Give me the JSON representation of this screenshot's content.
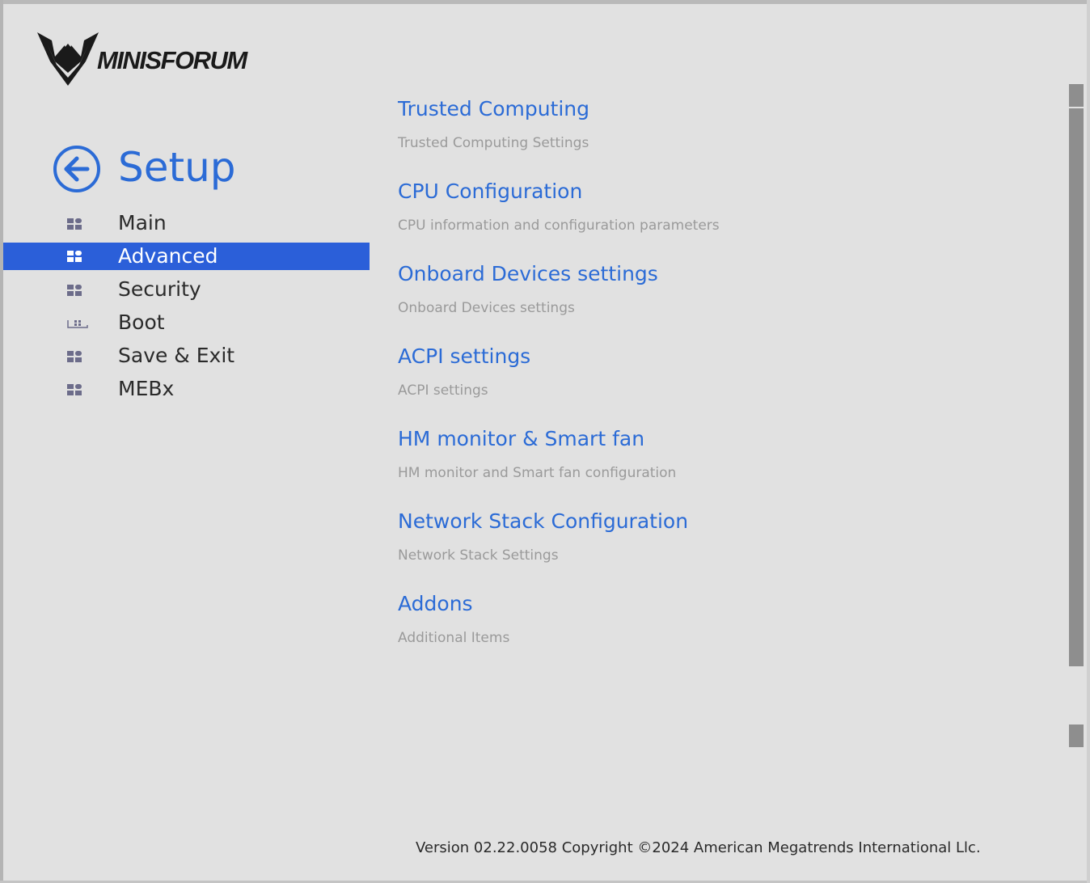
{
  "brand": {
    "logo_text": "MINISFORUM"
  },
  "setup": {
    "title": "Setup",
    "back_icon": "arrow-left-circle-icon"
  },
  "nav": {
    "items": [
      {
        "label": "Main",
        "icon": "grid-icon",
        "active": false
      },
      {
        "label": "Advanced",
        "icon": "grid-icon",
        "active": true
      },
      {
        "label": "Security",
        "icon": "grid-icon",
        "active": false
      },
      {
        "label": "Boot",
        "icon": "boot-drive-icon",
        "active": false
      },
      {
        "label": "Save & Exit",
        "icon": "grid-icon",
        "active": false
      },
      {
        "label": "MEBx",
        "icon": "grid-icon",
        "active": false
      }
    ]
  },
  "menu": {
    "items": [
      {
        "title": "Trusted Computing",
        "description": "Trusted Computing Settings"
      },
      {
        "title": "CPU Configuration",
        "description": "CPU information and configuration parameters"
      },
      {
        "title": "Onboard Devices settings",
        "description": "Onboard Devices settings"
      },
      {
        "title": "ACPI settings",
        "description": "ACPI settings"
      },
      {
        "title": "HM monitor & Smart fan",
        "description": "HM monitor and Smart fan configuration"
      },
      {
        "title": "Network Stack Configuration",
        "description": "Network Stack Settings"
      },
      {
        "title": "Addons",
        "description": "Additional Items"
      }
    ]
  },
  "footer": {
    "text": "Version 02.22.0058 Copyright ©2024 American Megatrends International Llc."
  },
  "colors": {
    "accent": "#2b6bd6",
    "highlight": "#2b5fd9",
    "background": "#e1e1e1",
    "description": "#9a9a9a"
  }
}
